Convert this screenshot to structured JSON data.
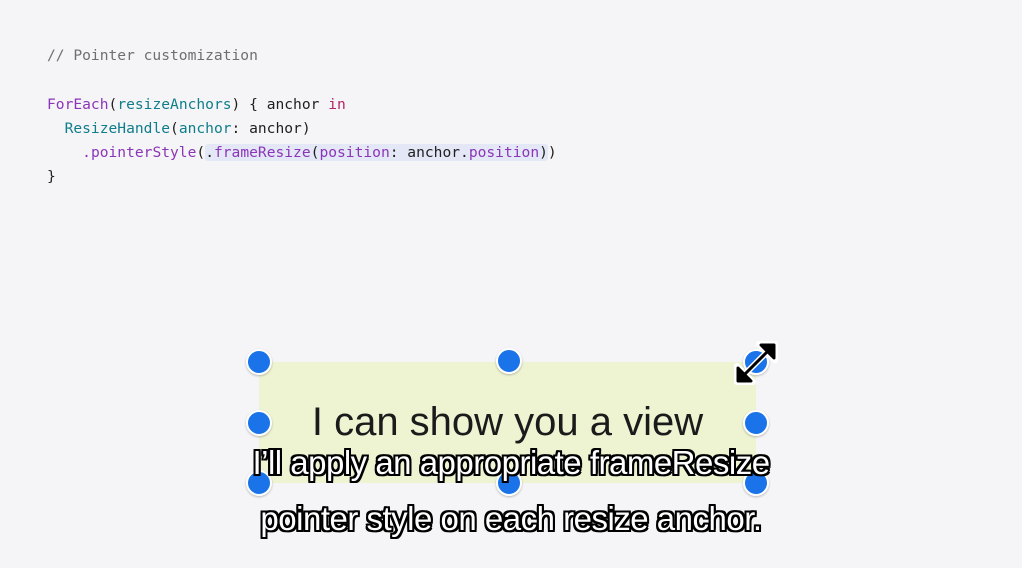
{
  "code": {
    "comment": "// Pointer customization",
    "l1_foreach": "ForEach",
    "l1_paren_open": "(",
    "l1_arg": "resizeAnchors",
    "l1_rest": ") { anchor ",
    "l1_kw": "in",
    "l2_indent": "  ",
    "l2_type": "ResizeHandle",
    "l2_paren": "(",
    "l2_label": "anchor",
    "l2_rest": ": anchor)",
    "l3_indent": "    ",
    "l3_method": ".pointerStyle",
    "l3_paren": "(",
    "l3_hl_dot": ".",
    "l3_hl_fn": "frameResize",
    "l3_hl_paren": "(",
    "l3_hl_label": "position",
    "l3_hl_mid": ": anchor.",
    "l3_hl_prop": "position",
    "l3_hl_close": ")",
    "l3_close": ")",
    "l4": "}"
  },
  "demo": {
    "view_text": "I can show you a view"
  },
  "subtitles": {
    "line1": "I’ll apply an appropriate frameResize",
    "line2": "pointer style on each resize anchor."
  },
  "colors": {
    "handle": "#1a73e8",
    "view_background": "#eef3d2",
    "code_purple": "#8b35b8",
    "code_teal": "#0f7d8a",
    "code_keyword": "#b4266a"
  }
}
